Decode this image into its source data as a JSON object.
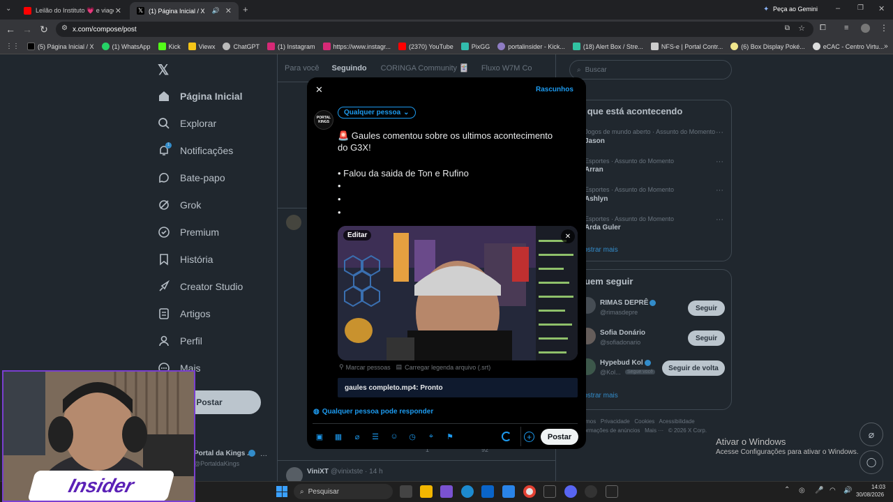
{
  "browser": {
    "tabs": [
      {
        "label": "Leilão do Instituto 💗 e viagem",
        "color": "#ff0000"
      },
      {
        "label": "(1) Página Inicial / X",
        "color": "#ffffff"
      }
    ],
    "gemini_label": "Peça ao Gemini",
    "url": "x.com/compose/post",
    "bookmarks": [
      "(5) Página Inicial / X",
      "(1) WhatsApp",
      "Kick",
      "Viewx",
      "ChatGPT",
      "(1) Instagram",
      "https://www.instagr...",
      "(2370) YouTube",
      "PixGG",
      "portalinsider - Kick...",
      "(18) Alert Box / Stre...",
      "NFS-e | Portal Contr...",
      "(6) Box Display Poké...",
      "eCAC - Centro Virtu..."
    ]
  },
  "sidebar": {
    "items": [
      {
        "label": "Página Inicial",
        "icon": "home-icon"
      },
      {
        "label": "Explorar",
        "icon": "search-icon"
      },
      {
        "label": "Notificações",
        "icon": "bell-icon"
      },
      {
        "label": "Bate-papo",
        "icon": "chat-icon"
      },
      {
        "label": "Grok",
        "icon": "grok-icon"
      },
      {
        "label": "Premium",
        "icon": "premium-icon"
      },
      {
        "label": "História",
        "icon": "bookmark-icon"
      },
      {
        "label": "Creator Studio",
        "icon": "rocket-icon"
      },
      {
        "label": "Artigos",
        "icon": "articles-icon"
      },
      {
        "label": "Perfil",
        "icon": "person-icon"
      },
      {
        "label": "Mais",
        "icon": "more-icon"
      }
    ],
    "post_button": "Postar",
    "account_name": "Portal da Kings ...",
    "account_handle": "@PortaldaKings",
    "notification_badge": "1"
  },
  "feed": {
    "tabs": [
      "Para você",
      "Seguindo",
      "CORINGA Community 🃏",
      "Fluxo W7M Co"
    ],
    "bottom_user": "ViniXT",
    "bottom_handle": "@vinixtste · 14 h",
    "reply_count": "1",
    "like_count": "92"
  },
  "right": {
    "search_placeholder": "Buscar",
    "trending_title": "O que está acontecendo",
    "trends": [
      {
        "meta": "Jogos de mundo aberto · Assunto do Momento",
        "name": "Jason"
      },
      {
        "meta": "Esportes · Assunto do Momento",
        "name": "Arran"
      },
      {
        "meta": "Esportes · Assunto do Momento",
        "name": "Ashlyn"
      },
      {
        "meta": "Esportes · Assunto do Momento",
        "name": "Arda Guler"
      }
    ],
    "show_more": "Mostrar mais",
    "follow_title": "Quem seguir",
    "follow": [
      {
        "name": "RIMAS DEPRÊ",
        "handle": "@rimasdepre",
        "button": "Seguir"
      },
      {
        "name": "Sofia Donário",
        "handle": "@sofiadonario",
        "button": "Seguir"
      },
      {
        "name": "Hypebud Kol",
        "handle": "@Kol...",
        "badge": "Segue você",
        "button": "Seguir de volta"
      }
    ],
    "show_more2": "Mostrar mais",
    "footer": [
      "Termos",
      "Privacidade",
      "Cookies",
      "Acessibilidade",
      "Informações de anúncios",
      "Mais ···",
      "© 2026 X Corp."
    ]
  },
  "modal": {
    "drafts": "Rascunhos",
    "audience": "Qualquer pessoa",
    "avatar_text": "PORTAL KINGS",
    "text_line1": "🚨 Gaules comentou sobre os ultimos acontecimento",
    "text_line2": "do G3X!",
    "text_line3": "• Falou da saida de Ton e Rufino",
    "bullet": "•",
    "edit_label": "Editar",
    "tag_people": "Marcar pessoas",
    "caption": "Carregar legenda arquivo (.srt)",
    "upload_status": "gaules completo.mp4: Pronto",
    "reply_setting": "Qualquer pessoa pode responder",
    "post_button": "Postar"
  },
  "windows": {
    "activate_title": "Ativar o Windows",
    "activate_sub": "Acesse Configurações para ativar o Windows.",
    "search": "Pesquisar",
    "time": "14:03",
    "date": "30/08/2026"
  },
  "webcam": {
    "logo": "Insider"
  }
}
